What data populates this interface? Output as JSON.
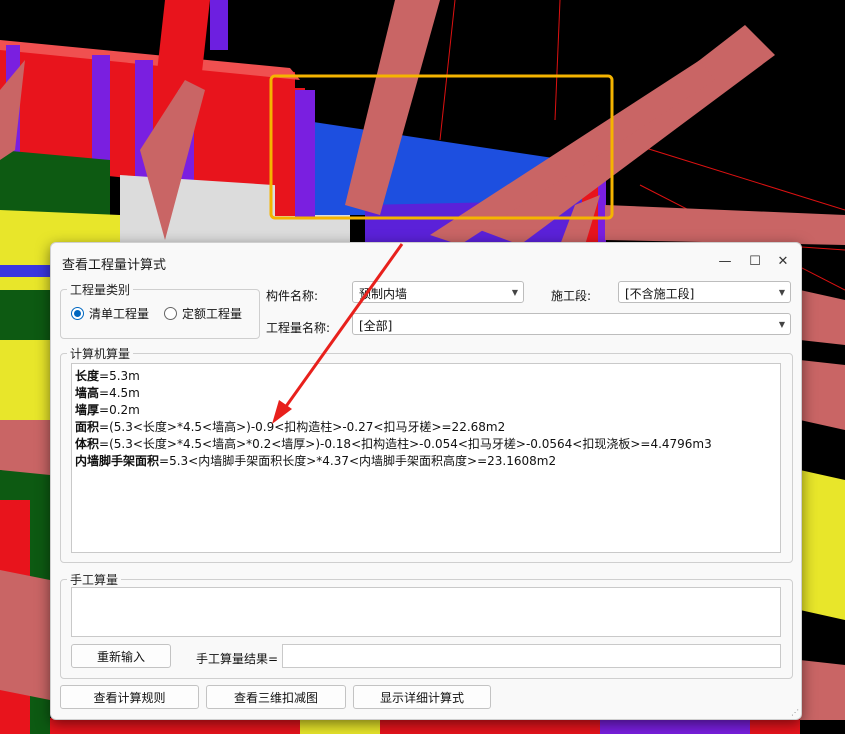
{
  "dialog": {
    "title": "查看工程量计算式",
    "minimize_glyph": "—",
    "maximize_glyph": "☐",
    "close_glyph": "✕"
  },
  "qty_type": {
    "legend": "工程量类别",
    "options": [
      {
        "label": "清单工程量",
        "selected": true
      },
      {
        "label": "定额工程量",
        "selected": false
      }
    ]
  },
  "component": {
    "label": "构件名称:",
    "value": "预制内墙"
  },
  "section": {
    "label": "施工段:",
    "value": "[不含施工段]"
  },
  "qty_name": {
    "label": "工程量名称:",
    "value": "[全部]"
  },
  "computer_calc": {
    "legend": "计算机算量",
    "lines": [
      {
        "name": "长度",
        "expr": "=5.3m"
      },
      {
        "name": "墙高",
        "expr": "=4.5m"
      },
      {
        "name": "墙厚",
        "expr": "=0.2m"
      },
      {
        "name": "面积",
        "expr": "=(5.3<长度>*4.5<墙高>)-0.9<扣构造柱>-0.27<扣马牙槎>=22.68m2"
      },
      {
        "name": "体积",
        "expr": "=(5.3<长度>*4.5<墙高>*0.2<墙厚>)-0.18<扣构造柱>-0.054<扣马牙槎>-0.0564<扣现浇板>=4.4796m3"
      },
      {
        "name": "内墙脚手架面积",
        "expr": "=5.3<内墙脚手架面积长度>*4.37<内墙脚手架面积高度>=23.1608m2"
      }
    ]
  },
  "manual_calc": {
    "legend": "手工算量",
    "reenter_label": "重新输入",
    "result_label": "手工算量结果=",
    "result_value": ""
  },
  "footer": {
    "rules_label": "查看计算规则",
    "view3d_label": "查看三维扣减图",
    "detail_label": "显示详细计算式"
  },
  "colors": {
    "accent": "#0067c0",
    "highlight_box": "#f5b400",
    "arrow": "#e8201c"
  }
}
